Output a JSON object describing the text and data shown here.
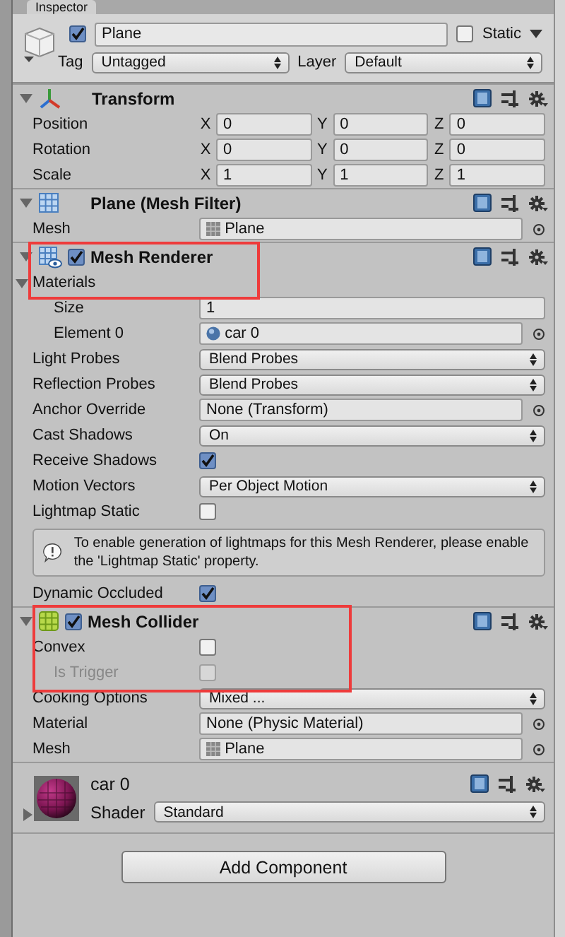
{
  "tab": {
    "title": "Inspector"
  },
  "object": {
    "active": true,
    "name": "Plane",
    "static": false,
    "static_label": "Static",
    "tag_label": "Tag",
    "tag": "Untagged",
    "layer_label": "Layer",
    "layer": "Default"
  },
  "components": [
    {
      "kind": "transform",
      "title": "Transform",
      "expanded": true,
      "rows": [
        {
          "kind": "vector",
          "label": "Position",
          "fields": [
            {
              "axis": "X",
              "value": "0"
            },
            {
              "axis": "Y",
              "value": "0"
            },
            {
              "axis": "Z",
              "value": "0"
            }
          ]
        },
        {
          "kind": "vector",
          "label": "Rotation",
          "fields": [
            {
              "axis": "X",
              "value": "0"
            },
            {
              "axis": "Y",
              "value": "0"
            },
            {
              "axis": "Z",
              "value": "0"
            }
          ]
        },
        {
          "kind": "vector",
          "label": "Scale",
          "fields": [
            {
              "axis": "X",
              "value": "1"
            },
            {
              "axis": "Y",
              "value": "1"
            },
            {
              "axis": "Z",
              "value": "1"
            }
          ]
        }
      ]
    },
    {
      "kind": "mesh_filter",
      "title": "Plane (Mesh Filter)",
      "expanded": true,
      "rows": [
        {
          "kind": "mesh_ref",
          "label": "Mesh",
          "value": "Plane"
        }
      ]
    },
    {
      "kind": "mesh_renderer",
      "title": "Mesh Renderer",
      "enabled": true,
      "expanded": true,
      "highlighted": true,
      "rows": [
        {
          "kind": "foldout",
          "label": "Materials",
          "expanded": true,
          "children": [
            {
              "kind": "field",
              "label": "Size",
              "value": "1"
            },
            {
              "kind": "material_ref",
              "label": "Element 0",
              "value": "car 0"
            }
          ]
        },
        {
          "kind": "dropdown",
          "label": "Light Probes",
          "value": "Blend Probes"
        },
        {
          "kind": "dropdown",
          "label": "Reflection Probes",
          "value": "Blend Probes"
        },
        {
          "kind": "object",
          "label": "Anchor Override",
          "value": "None (Transform)"
        },
        {
          "kind": "dropdown",
          "label": "Cast Shadows",
          "value": "On"
        },
        {
          "kind": "checkbox",
          "label": "Receive Shadows",
          "checked": true
        },
        {
          "kind": "dropdown",
          "label": "Motion Vectors",
          "value": "Per Object Motion"
        },
        {
          "kind": "checkbox",
          "label": "Lightmap Static",
          "checked": false
        },
        {
          "kind": "helpbox",
          "text": "To enable generation of lightmaps for this Mesh Renderer, please enable the 'Lightmap Static' property."
        },
        {
          "kind": "checkbox",
          "label": "Dynamic Occluded",
          "checked": true
        }
      ]
    },
    {
      "kind": "mesh_collider",
      "title": "Mesh Collider",
      "enabled": true,
      "expanded": true,
      "highlighted": true,
      "rows": [
        {
          "kind": "checkbox",
          "label": "Convex",
          "checked": false,
          "children": [
            {
              "kind": "checkbox",
              "label": "Is Trigger",
              "checked": false,
              "disabled": true
            }
          ]
        },
        {
          "kind": "dropdown",
          "label": "Cooking Options",
          "value": "Mixed ..."
        },
        {
          "kind": "object",
          "label": "Material",
          "value": "None (Physic Material)"
        },
        {
          "kind": "mesh_ref",
          "label": "Mesh",
          "value": "Plane"
        }
      ]
    },
    {
      "kind": "material",
      "title": "car 0",
      "expanded": false,
      "shader_label": "Shader",
      "shader": "Standard"
    }
  ],
  "add_button": "Add Component"
}
